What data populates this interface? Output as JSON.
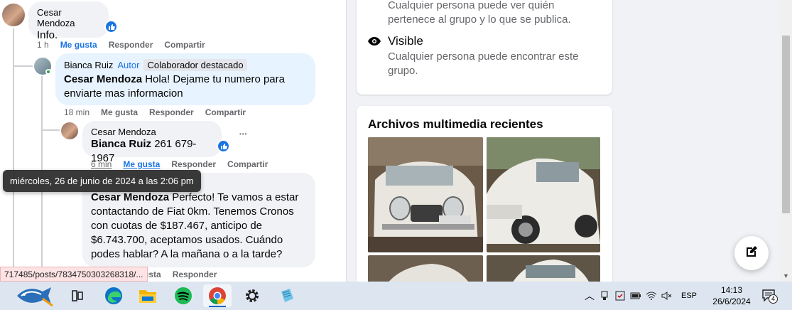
{
  "feed": {
    "comment1": {
      "author": "Cesar Mendoza",
      "text": "Info.",
      "time": "1 h",
      "like": "Me gusta",
      "reply": "Responder",
      "share": "Compartir"
    },
    "comment2": {
      "author": "Bianca Ruiz",
      "author_tag": "Autor",
      "badge": "Colaborador destacado",
      "mention": "Cesar Mendoza",
      "text": " Hola! Dejame tu numero para enviarte mas informacion",
      "time": "18 min",
      "like": "Me gusta",
      "reply": "Responder",
      "share": "Compartir"
    },
    "comment3": {
      "author": "Cesar Mendoza",
      "mention": "Bianca Ruiz",
      "text": " 261 679-1967",
      "time": "6 min",
      "like": "Me gusta",
      "reply": "Responder",
      "share": "Compartir",
      "more": "•••"
    },
    "comment4": {
      "mention": "Cesar Mendoza",
      "text": " Perfecto! Te vamos a estar contactando de Fiat 0km. Tenemos Cronos con cuotas de $187.467, anticipo de $6.743.700, aceptamos usados. Cuándo podes hablar? A la mañana o a la tarde?",
      "share_partial": "usta",
      "reply": "Responder"
    },
    "tooltip": "miércoles, 26 de junio de 2024 a las 2:06 pm",
    "status_url": "717485/posts/7834750303268318/..."
  },
  "about": {
    "privacy_desc": "Cualquier persona puede ver quién pertenece al grupo y lo que se publica.",
    "visible_title": "Visible",
    "visible_desc": "Cualquier persona puede encontrar este grupo.",
    "visible_icon": "eye-icon"
  },
  "media": {
    "title": "Archivos multimedia recientes"
  },
  "taskbar": {
    "apps": [
      "task-view",
      "edge",
      "file-explorer",
      "spotify",
      "chrome",
      "settings",
      "notepad"
    ],
    "lang": "ESP",
    "time": "14:13",
    "date": "26/6/2024",
    "notifications": "4"
  },
  "colors": {
    "accent": "#1b74e4",
    "muted": "#65676b"
  }
}
